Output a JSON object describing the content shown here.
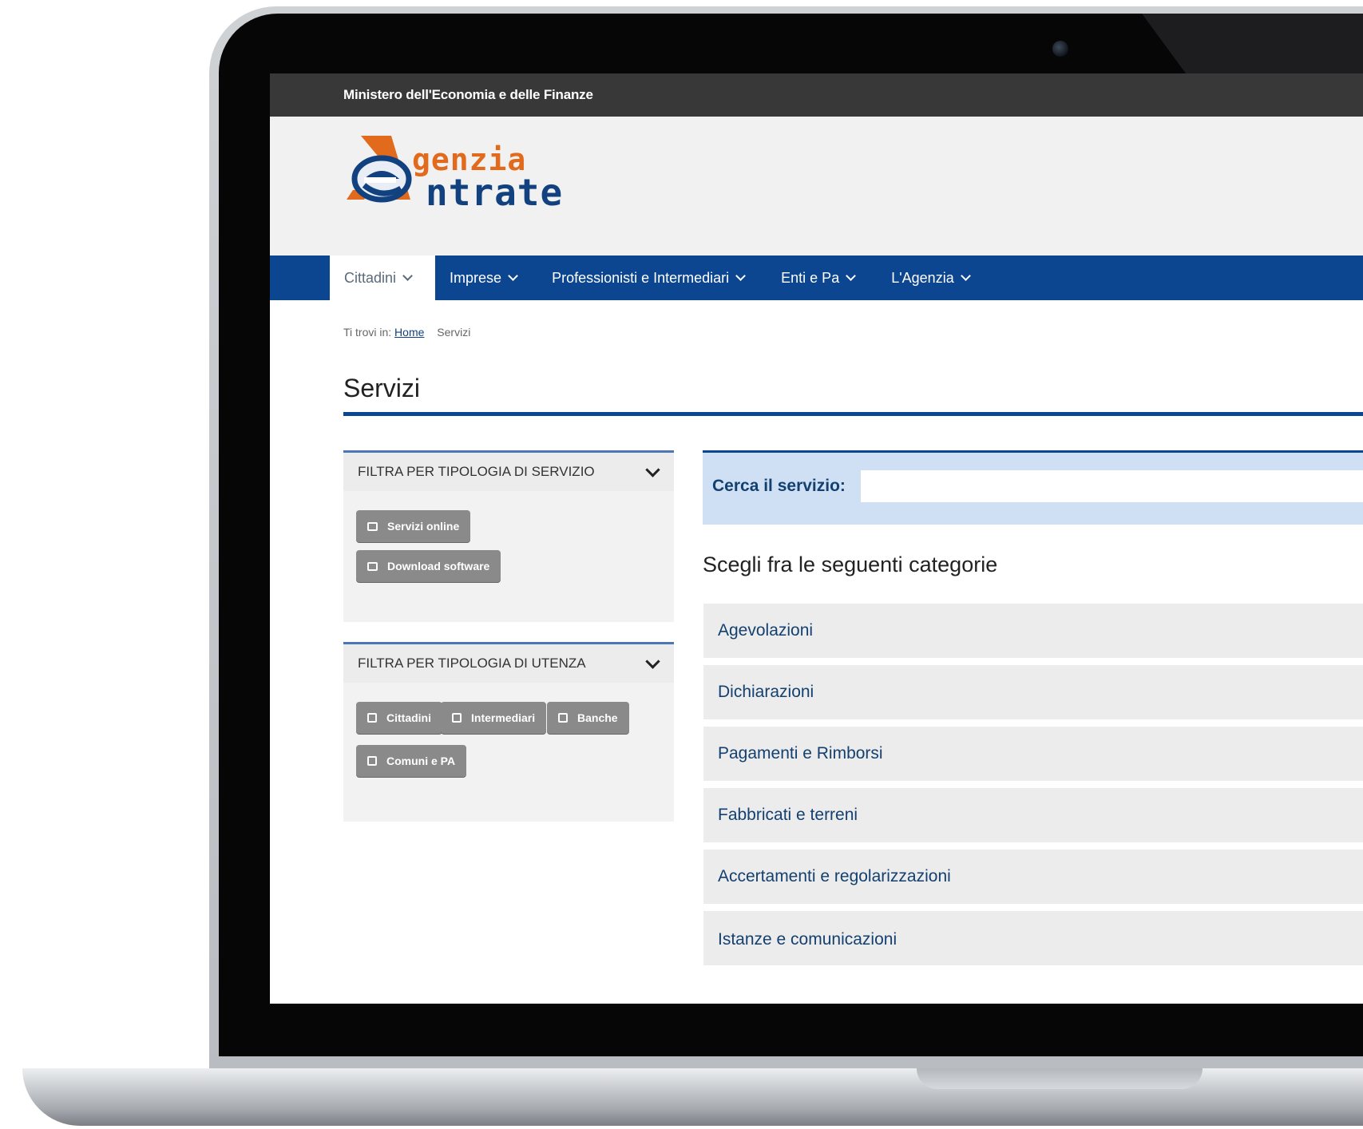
{
  "top_bar": {
    "ministry": "Ministero dell'Economia e delle Finanze"
  },
  "logo": {
    "line1": "genzia",
    "line2": "ntrate"
  },
  "nav": {
    "items": [
      {
        "label": "Cittadini"
      },
      {
        "label": "Imprese"
      },
      {
        "label": "Professionisti e Intermediari"
      },
      {
        "label": "Enti e Pa"
      },
      {
        "label": "L'Agenzia"
      }
    ]
  },
  "breadcrumb": {
    "prefix": "Ti trovi in:",
    "home": "Home",
    "current": "Servizi"
  },
  "page": {
    "title": "Servizi"
  },
  "filters": {
    "service_type": {
      "heading": "FILTRA PER TIPOLOGIA DI SERVIZIO",
      "buttons": [
        "Servizi online",
        "Download software"
      ]
    },
    "user_type": {
      "heading": "FILTRA PER TIPOLOGIA DI UTENZA",
      "buttons": [
        "Cittadini",
        "Intermediari",
        "Banche",
        "Comuni e PA"
      ]
    }
  },
  "search": {
    "label": "Cerca il servizio:",
    "value": ""
  },
  "categories": {
    "heading": "Scegli fra le seguenti categorie",
    "items": [
      "Agevolazioni",
      "Dichiarazioni",
      "Pagamenti e Rimborsi",
      "Fabbricati e terreni",
      "Accertamenti e regolarizzazioni",
      "Istanze e comunicazioni"
    ]
  },
  "colors": {
    "nav_blue": "#0c4590",
    "top_bar": "#383838",
    "logo_orange": "#e26a1c",
    "link_blue": "#14406f",
    "search_bg": "#cfe0f5",
    "filter_button": "#8a8a8a"
  }
}
